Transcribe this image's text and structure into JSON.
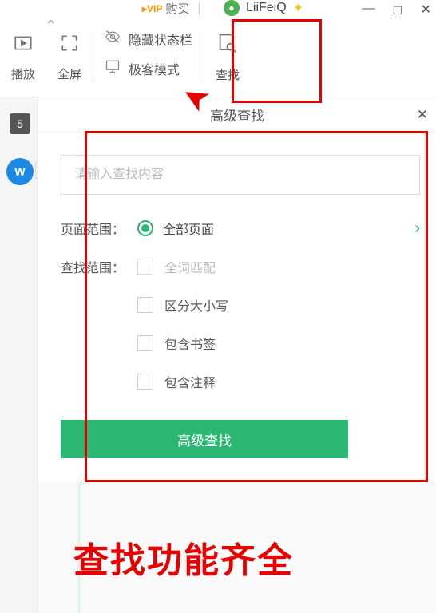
{
  "header": {
    "vip_label": "购买",
    "user_name": "LiiFeiQ"
  },
  "toolbar": {
    "play_label": "播放",
    "fullscreen_label": "全屏",
    "hide_status_label": "隐藏状态栏",
    "geek_mode_label": "极客模式",
    "find_label": "查找"
  },
  "sidebar": {
    "page_number": "5",
    "badge": "W"
  },
  "panel": {
    "title": "高级查找",
    "search_placeholder": "请输入查找内容",
    "page_range_label": "页面范围：",
    "page_range_value": "全部页面",
    "find_range_label": "查找范围：",
    "options": {
      "whole_word": "全词匹配",
      "case_sensitive": "区分大小写",
      "include_bookmarks": "包含书签",
      "include_comments": "包含注释"
    },
    "submit_label": "高级查找"
  },
  "caption": "查找功能齐全"
}
